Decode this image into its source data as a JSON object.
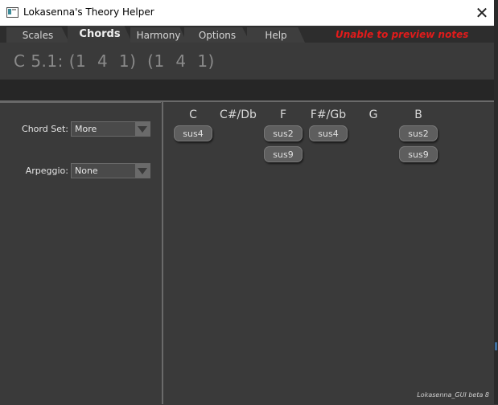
{
  "window": {
    "title": "Lokasenna's Theory Helper",
    "close_icon": "close-icon"
  },
  "tabs": [
    {
      "label": "Scales",
      "active": false
    },
    {
      "label": "Chords",
      "active": true
    },
    {
      "label": "Harmony",
      "active": false
    },
    {
      "label": "Options",
      "active": false
    },
    {
      "label": "Help",
      "active": false
    }
  ],
  "warning": "Unable to preview notes",
  "chord_display": "C 5.1: (1  4  1)  (1  4  1)",
  "left_panel": {
    "chord_set_label": "Chord Set:",
    "chord_set_value": "More",
    "arpeggio_label": "Arpeggio:",
    "arpeggio_value": "None"
  },
  "notes": [
    {
      "name": "C",
      "chords": [
        "sus4"
      ]
    },
    {
      "name": "C#/Db",
      "chords": []
    },
    {
      "name": "F",
      "chords": [
        "sus2",
        "sus9"
      ]
    },
    {
      "name": "F#/Gb",
      "chords": [
        "sus4"
      ]
    },
    {
      "name": "G",
      "chords": []
    },
    {
      "name": "B",
      "chords": [
        "sus2",
        "sus9"
      ]
    }
  ],
  "footer": "Lokasenna_GUI beta 8",
  "colors": {
    "background": "#3a3a3a",
    "warning": "#e11b1b",
    "button": "#5e5e5e"
  }
}
